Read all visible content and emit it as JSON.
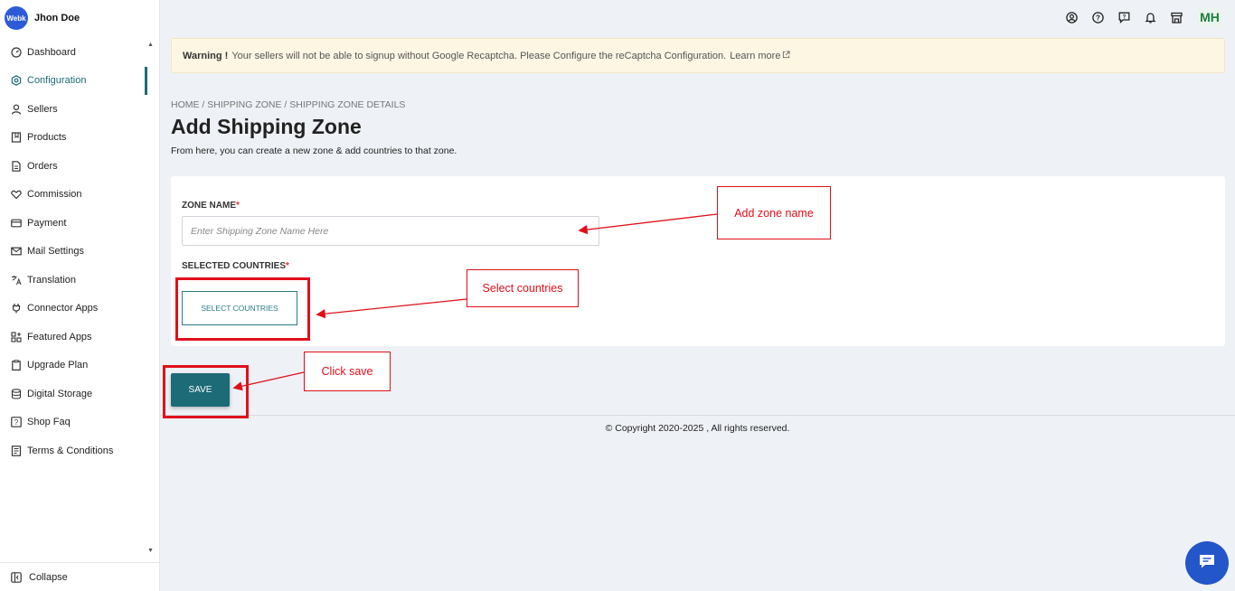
{
  "brand": {
    "logo_text": "Webk",
    "user_name": "Jhon Doe"
  },
  "sidebar": {
    "items": [
      {
        "label": "Dashboard",
        "icon": "dashboard-icon"
      },
      {
        "label": "Configuration",
        "icon": "config-icon",
        "active": true
      },
      {
        "label": "Sellers",
        "icon": "user-icon"
      },
      {
        "label": "Products",
        "icon": "book-icon"
      },
      {
        "label": "Orders",
        "icon": "document-icon"
      },
      {
        "label": "Commission",
        "icon": "handshake-icon"
      },
      {
        "label": "Payment",
        "icon": "card-icon"
      },
      {
        "label": "Mail Settings",
        "icon": "mail-icon"
      },
      {
        "label": "Translation",
        "icon": "translate-icon"
      },
      {
        "label": "Connector Apps",
        "icon": "plug-icon"
      },
      {
        "label": "Featured Apps",
        "icon": "apps-icon"
      },
      {
        "label": "Upgrade Plan",
        "icon": "clipboard-icon"
      },
      {
        "label": "Digital Storage",
        "icon": "database-icon"
      },
      {
        "label": "Shop Faq",
        "icon": "faq-icon"
      },
      {
        "label": "Terms & Conditions",
        "icon": "terms-icon"
      }
    ],
    "collapse_label": "Collapse"
  },
  "topbar": {
    "avatar_initials": "MH"
  },
  "warning": {
    "title": "Warning !",
    "message": "Your sellers will not be able to signup without Google Recaptcha. Please Configure the reCaptcha Configuration.",
    "link": "Learn more"
  },
  "breadcrumb": "HOME / SHIPPING ZONE / SHIPPING ZONE DETAILS",
  "page": {
    "title": "Add Shipping Zone",
    "subtitle": "From here, you can create a new zone & add countries to that zone."
  },
  "form": {
    "zone_name_label": "ZONE NAME",
    "zone_name_placeholder": "Enter Shipping Zone Name Here",
    "zone_name_value": "",
    "countries_label": "SELECTED COUNTRIES",
    "required_mark": "*",
    "select_countries_button": "SELECT COUNTRIES",
    "save_button": "SAVE"
  },
  "footer": {
    "copyright": "© Copyright 2020-2025 , All rights reserved."
  },
  "annotations": {
    "add_zone_name": "Add zone name",
    "select_countries": "Select countries",
    "click_save": "Click save"
  },
  "colors": {
    "accent": "#1d6b77",
    "annotation": "#e0101a",
    "chat": "#2356c9"
  }
}
